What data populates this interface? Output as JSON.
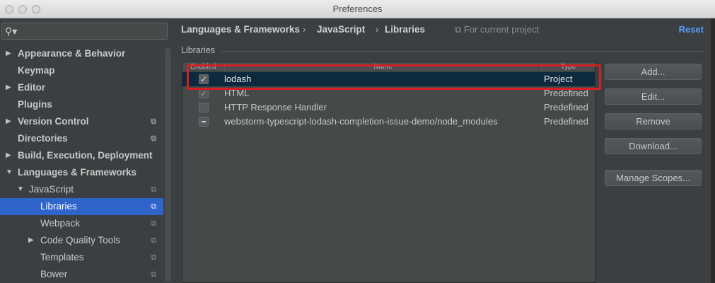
{
  "window": {
    "title": "Preferences"
  },
  "search": {
    "placeholder": ""
  },
  "sidebar": {
    "items": [
      {
        "label": "Appearance & Behavior",
        "arrow": "▶",
        "bold": true
      },
      {
        "label": "Keymap",
        "bold": true
      },
      {
        "label": "Editor",
        "arrow": "▶",
        "bold": true
      },
      {
        "label": "Plugins",
        "bold": true
      },
      {
        "label": "Version Control",
        "arrow": "▶",
        "bold": true,
        "project_icon": "⧉"
      },
      {
        "label": "Directories",
        "bold": true,
        "project_icon": "⧉"
      },
      {
        "label": "Build, Execution, Deployment",
        "arrow": "▶",
        "bold": true
      },
      {
        "label": "Languages & Frameworks",
        "arrow": "▼",
        "bold": true
      },
      {
        "label": "JavaScript",
        "arrow": "▼",
        "project_icon": "⧉"
      },
      {
        "label": "Libraries",
        "project_icon": "⧉",
        "selected": true
      },
      {
        "label": "Webpack",
        "project_icon": "⧉"
      },
      {
        "label": "Code Quality Tools",
        "arrow": "▶",
        "project_icon": "⧉"
      },
      {
        "label": "Templates",
        "project_icon": "⧉"
      },
      {
        "label": "Bower",
        "project_icon": "⧉"
      }
    ]
  },
  "header": {
    "breadcrumb": [
      "Languages & Frameworks",
      "JavaScript",
      "Libraries"
    ],
    "separator": "›",
    "scope_icon": "⧉",
    "scope": "For current project",
    "reset": "Reset"
  },
  "section": {
    "label": "Libraries"
  },
  "table": {
    "columns": [
      "Enabled",
      "Name",
      "Type"
    ],
    "rows": [
      {
        "checked": "✓",
        "name": "lodash",
        "type": "Project",
        "selected": true
      },
      {
        "checked": "✓",
        "name": "HTML",
        "type": "Predefined"
      },
      {
        "checked": "",
        "name": "HTTP Response Handler",
        "type": "Predefined"
      },
      {
        "checked": "mixed",
        "name": "webstorm-typescript-lodash-completion-issue-demo/node_modules",
        "type": "Predefined"
      }
    ]
  },
  "buttons": {
    "add": "Add...",
    "edit": "Edit...",
    "remove": "Remove",
    "download": "Download...",
    "manage_scopes": "Manage Scopes..."
  },
  "colors": {
    "selection": "#2f65ca",
    "link": "#589df6",
    "highlight": "#d42020"
  }
}
